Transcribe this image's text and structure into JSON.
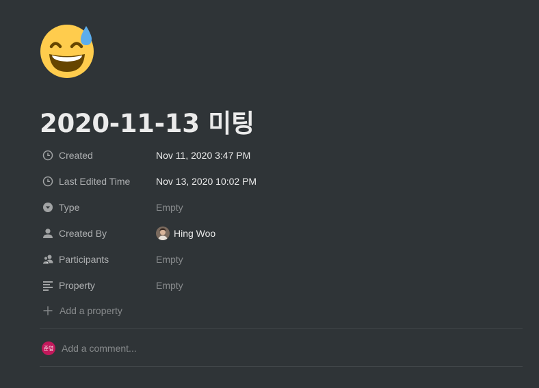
{
  "page": {
    "icon": "grinning-face-with-sweat-icon",
    "title": "2020-11-13 미팅"
  },
  "properties": [
    {
      "key": "Created",
      "icon": "clock-icon",
      "value": "Nov 11, 2020 3:47 PM",
      "empty": false
    },
    {
      "key": "Last Edited Time",
      "icon": "clock-icon",
      "value": "Nov 13, 2020 10:02 PM",
      "empty": false
    },
    {
      "key": "Type",
      "icon": "select-icon",
      "value": "Empty",
      "empty": true
    },
    {
      "key": "Created By",
      "icon": "person-icon",
      "value": "Hing Woo",
      "empty": false
    },
    {
      "key": "Participants",
      "icon": "people-icon",
      "value": "Empty",
      "empty": true
    },
    {
      "key": "Property",
      "icon": "text-lines-icon",
      "value": "Empty",
      "empty": true
    }
  ],
  "add_property": {
    "label": "Add a property",
    "icon": "plus-icon"
  },
  "comment": {
    "avatar_text": "준영",
    "avatar_color": "#c2185b",
    "placeholder": "Add a comment..."
  },
  "colors": {
    "background": "#2f3437",
    "text": "#ebebeb",
    "muted": "#9b9b9b"
  }
}
